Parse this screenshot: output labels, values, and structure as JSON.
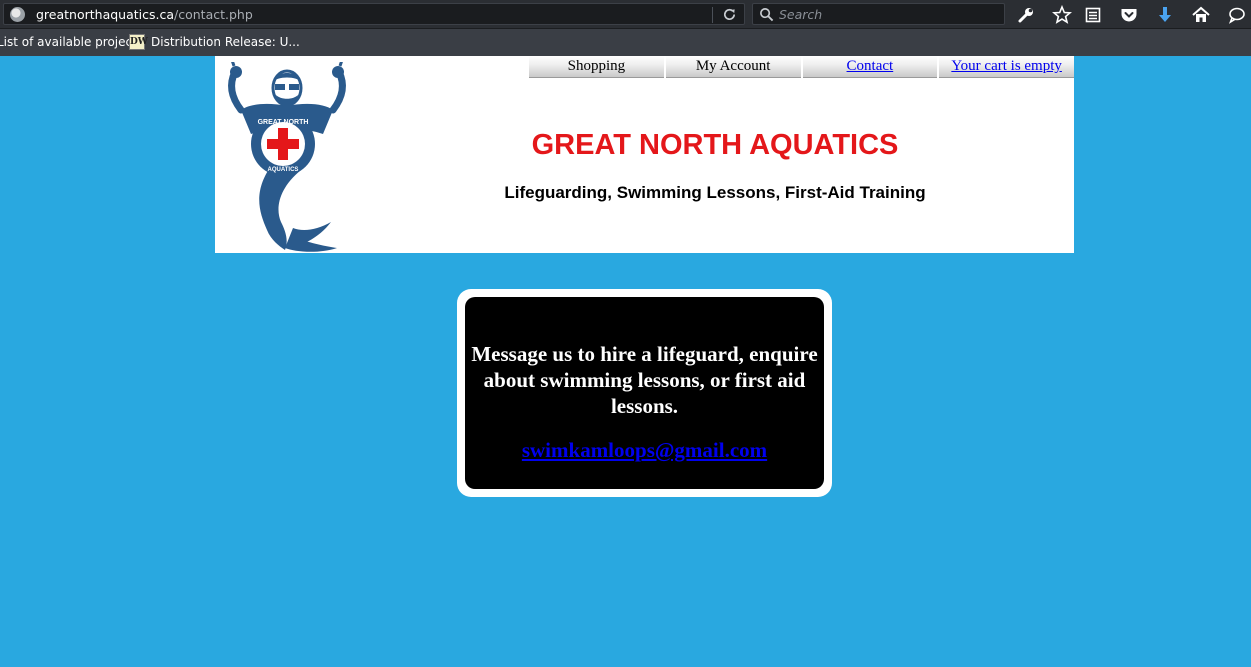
{
  "browser": {
    "url_domain": "greatnorthaquatics.ca",
    "url_path": "/contact.php",
    "search_placeholder": "Search",
    "bookmarks": [
      {
        "label": "List of available projec..."
      },
      {
        "label": "Distribution Release: U..."
      }
    ],
    "bookmark_icon_text": "DW",
    "icons": [
      "site-identity-icon",
      "reload-icon",
      "search-icon",
      "wrench-icon",
      "star-icon",
      "reader-list-icon",
      "pocket-icon",
      "download-icon",
      "home-icon",
      "chat-icon"
    ]
  },
  "header": {
    "nav": [
      {
        "label": "Shopping"
      },
      {
        "label": "My Account"
      },
      {
        "label": "Contact"
      },
      {
        "label": "Your cart is empty"
      }
    ],
    "title": "GREAT NORTH AQUATICS",
    "subtitle": "Lifeguarding, Swimming Lessons, First-Aid Training",
    "logo_text_top": "GREAT NORTH",
    "logo_text_bottom": "AQUATICS"
  },
  "contact": {
    "message": "Message us to hire a lifeguard, enquire about swimming lessons, or first aid lessons.",
    "email": "swimkamloops@gmail.com"
  },
  "colors": {
    "page_background": "#29a8e0",
    "title_red": "#e4171a",
    "link_blue": "#0000ee",
    "logo_blue": "#2a5a8c"
  }
}
